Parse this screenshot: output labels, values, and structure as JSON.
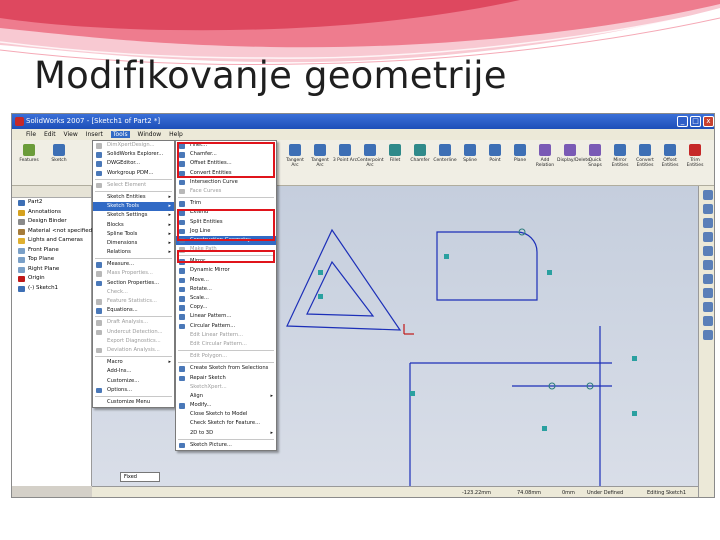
{
  "slide": {
    "title": "Modifikovanje geometrije",
    "accent_colors": {
      "wave_dark": "#e14f63",
      "wave_light": "#f5a9b6",
      "highlight": "#e0141b"
    }
  },
  "window": {
    "title": "SolidWorks 2007 - [Sketch1 of Part2 *]",
    "controls": [
      "_",
      "□",
      "x"
    ]
  },
  "menubar": [
    "File",
    "Edit",
    "View",
    "Insert",
    "Tools",
    "Window",
    "Help"
  ],
  "selected_menu": "Tools",
  "command_tools_left": [
    "Features",
    "Sketch"
  ],
  "command_tools_right": [
    "Tangent Arc",
    "Tangent Arc",
    "3 Point Arc",
    "Centerpoint Arc",
    "Fillet",
    "Chamfer",
    "Centerline",
    "Spline",
    "Point",
    "Plane",
    "Add Relation",
    "Display/Delete",
    "Quick Snaps",
    "Mirror Entities",
    "Convert Entities",
    "Offset Entities",
    "Trim Entities"
  ],
  "feature_tree": [
    "Part2",
    "Annotations",
    "Design Binder",
    "Material <not specified>",
    "Lights and Cameras",
    "Front Plane",
    "Top Plane",
    "Right Plane",
    "Origin",
    "(-) Sketch1"
  ],
  "unit_box": "Fixed",
  "tools_menu": [
    {
      "label": "DimXpertDesign...",
      "icon": "dimxpert-icon",
      "disabled": true
    },
    {
      "label": "SolidWorks Explorer...",
      "icon": "explorer-icon"
    },
    {
      "label": "DWGEditor...",
      "icon": "dwg-icon"
    },
    {
      "label": "Workgroup PDM...",
      "icon": "pdm-icon"
    },
    {
      "sep": true
    },
    {
      "label": "Select Element",
      "icon": "select-icon",
      "disabled": true
    },
    {
      "sep": true
    },
    {
      "label": "Sketch Entities",
      "submenu": true
    },
    {
      "label": "Sketch Tools",
      "submenu": true,
      "highlighted": true
    },
    {
      "label": "Sketch Settings",
      "submenu": true
    },
    {
      "label": "Blocks",
      "submenu": true
    },
    {
      "label": "Spline Tools",
      "submenu": true
    },
    {
      "label": "Dimensions",
      "submenu": true
    },
    {
      "label": "Relations",
      "submenu": true
    },
    {
      "sep": true
    },
    {
      "label": "Measure...",
      "icon": "measure-icon"
    },
    {
      "label": "Mass Properties...",
      "icon": "mass-icon",
      "disabled": true
    },
    {
      "label": "Section Properties...",
      "icon": "section-icon"
    },
    {
      "label": "Check...",
      "disabled": true
    },
    {
      "label": "Feature Statistics...",
      "icon": "stats-icon",
      "disabled": true
    },
    {
      "label": "Equations...",
      "icon": "equations-icon"
    },
    {
      "sep": true
    },
    {
      "label": "Draft Analysis...",
      "icon": "draft-icon",
      "disabled": true
    },
    {
      "label": "Undercut Detection...",
      "icon": "undercut-icon",
      "disabled": true
    },
    {
      "label": "Export Diagnostics...",
      "disabled": true
    },
    {
      "label": "Deviation Analysis...",
      "icon": "deviation-icon",
      "disabled": true
    },
    {
      "sep": true
    },
    {
      "label": "Macro",
      "submenu": true
    },
    {
      "label": "Add-Ins..."
    },
    {
      "label": "Customize..."
    },
    {
      "label": "Options...",
      "icon": "options-icon"
    },
    {
      "sep": true
    },
    {
      "label": "Customize Menu"
    }
  ],
  "sketch_tools_menu": [
    {
      "label": "Fillet...",
      "icon": "fillet-icon"
    },
    {
      "label": "Chamfer...",
      "icon": "chamfer-icon"
    },
    {
      "label": "Offset Entities...",
      "icon": "offset-icon"
    },
    {
      "label": "Convert Entities",
      "icon": "convert-icon"
    },
    {
      "label": "Intersection Curve",
      "icon": "intersection-icon"
    },
    {
      "label": "Face Curves",
      "icon": "face-curves-icon",
      "disabled": true
    },
    {
      "sep": true
    },
    {
      "label": "Trim",
      "icon": "trim-icon"
    },
    {
      "label": "Extend",
      "icon": "extend-icon"
    },
    {
      "label": "Split Entities",
      "icon": "split-icon"
    },
    {
      "label": "Jog Line",
      "icon": "jog-icon"
    },
    {
      "label": "Construction Geometry",
      "icon": "construction-icon",
      "highlighted": true
    },
    {
      "label": "Make Path",
      "icon": "path-icon",
      "disabled": true
    },
    {
      "sep": true
    },
    {
      "label": "Mirror",
      "icon": "mirror-icon"
    },
    {
      "label": "Dynamic Mirror",
      "icon": "dynamic-mirror-icon"
    },
    {
      "label": "Move...",
      "icon": "move-icon"
    },
    {
      "label": "Rotate...",
      "icon": "rotate-icon"
    },
    {
      "label": "Scale...",
      "icon": "scale-icon"
    },
    {
      "label": "Copy...",
      "icon": "copy-icon"
    },
    {
      "label": "Linear Pattern...",
      "icon": "linear-pattern-icon"
    },
    {
      "label": "Circular Pattern...",
      "icon": "circular-pattern-icon"
    },
    {
      "label": "Edit Linear Pattern...",
      "disabled": true
    },
    {
      "label": "Edit Circular Pattern...",
      "disabled": true
    },
    {
      "sep": true
    },
    {
      "label": "Edit Polygon...",
      "disabled": true
    },
    {
      "sep": true
    },
    {
      "label": "Create Sketch from Selections",
      "icon": "create-sketch-icon"
    },
    {
      "label": "Repair Sketch",
      "icon": "repair-icon"
    },
    {
      "label": "SketchXpert...",
      "disabled": true
    },
    {
      "label": "Align",
      "submenu": true
    },
    {
      "label": "Modify...",
      "icon": "modify-icon"
    },
    {
      "label": "Close Sketch to Model"
    },
    {
      "label": "Check Sketch for Feature..."
    },
    {
      "label": "2D to 3D",
      "submenu": true
    },
    {
      "sep": true
    },
    {
      "label": "Sketch Picture...",
      "icon": "picture-icon"
    }
  ],
  "status": {
    "x": "-123.22mm",
    "y": "74.08mm",
    "z": "0mm",
    "state": "Under Defined",
    "mode": "Editing Sketch1"
  }
}
